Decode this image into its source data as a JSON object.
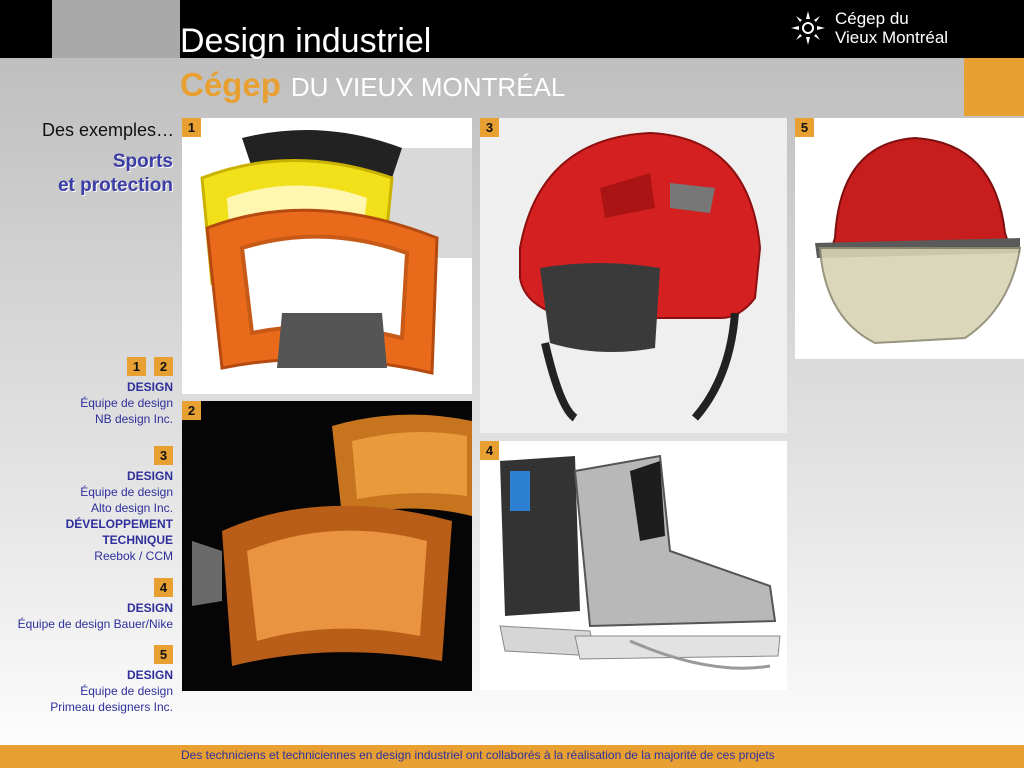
{
  "header": {
    "title": "Design industriel",
    "subtitle_cegep": "Cégep",
    "subtitle_rest": "DU VIEUX MONTRÉAL",
    "logo_line1": "Cégep du",
    "logo_line2": "Vieux Montréal"
  },
  "sidebar": {
    "heading": "Des exemples…",
    "category_line1": "Sports",
    "category_line2": "et protection"
  },
  "credits": [
    {
      "numbers": [
        "1",
        "2"
      ],
      "lines": [
        {
          "text": "DESIGN",
          "bold": true
        },
        {
          "text": "Équipe de design",
          "bold": false
        },
        {
          "text": "NB design Inc.",
          "bold": false
        }
      ]
    },
    {
      "numbers": [
        "3"
      ],
      "lines": [
        {
          "text": "DESIGN",
          "bold": true
        },
        {
          "text": "Équipe de design",
          "bold": false
        },
        {
          "text": "Alto design Inc.",
          "bold": false
        },
        {
          "text": "DÉVELOPPEMENT",
          "bold": true
        },
        {
          "text": "TECHNIQUE",
          "bold": true
        },
        {
          "text": "Reebok / CCM",
          "bold": false
        }
      ]
    },
    {
      "numbers": [
        "4"
      ],
      "lines": [
        {
          "text": "DESIGN",
          "bold": true
        },
        {
          "text": "Équipe de design Bauer/Nike",
          "bold": false
        }
      ]
    },
    {
      "numbers": [
        "5"
      ],
      "lines": [
        {
          "text": "DESIGN",
          "bold": true
        },
        {
          "text": "Équipe de design",
          "bold": false
        },
        {
          "text": "Primeau designers Inc.",
          "bold": false
        }
      ]
    }
  ],
  "photos": [
    {
      "number": "1",
      "subject": "goggles-stack-photo"
    },
    {
      "number": "2",
      "subject": "orange-goggles-photo"
    },
    {
      "number": "3",
      "subject": "hockey-helmet-photo"
    },
    {
      "number": "4",
      "subject": "hockey-skate-photo"
    },
    {
      "number": "5",
      "subject": "firefighter-helmet-photo"
    }
  ],
  "footer": {
    "text": "Des techniciens et techniciennes en design industriel ont collaborés à la réalisation de la majorité de ces projets"
  },
  "colors": {
    "accent_orange": "#e8a033",
    "credit_blue": "#2f2f9c",
    "header_black": "#000000"
  }
}
